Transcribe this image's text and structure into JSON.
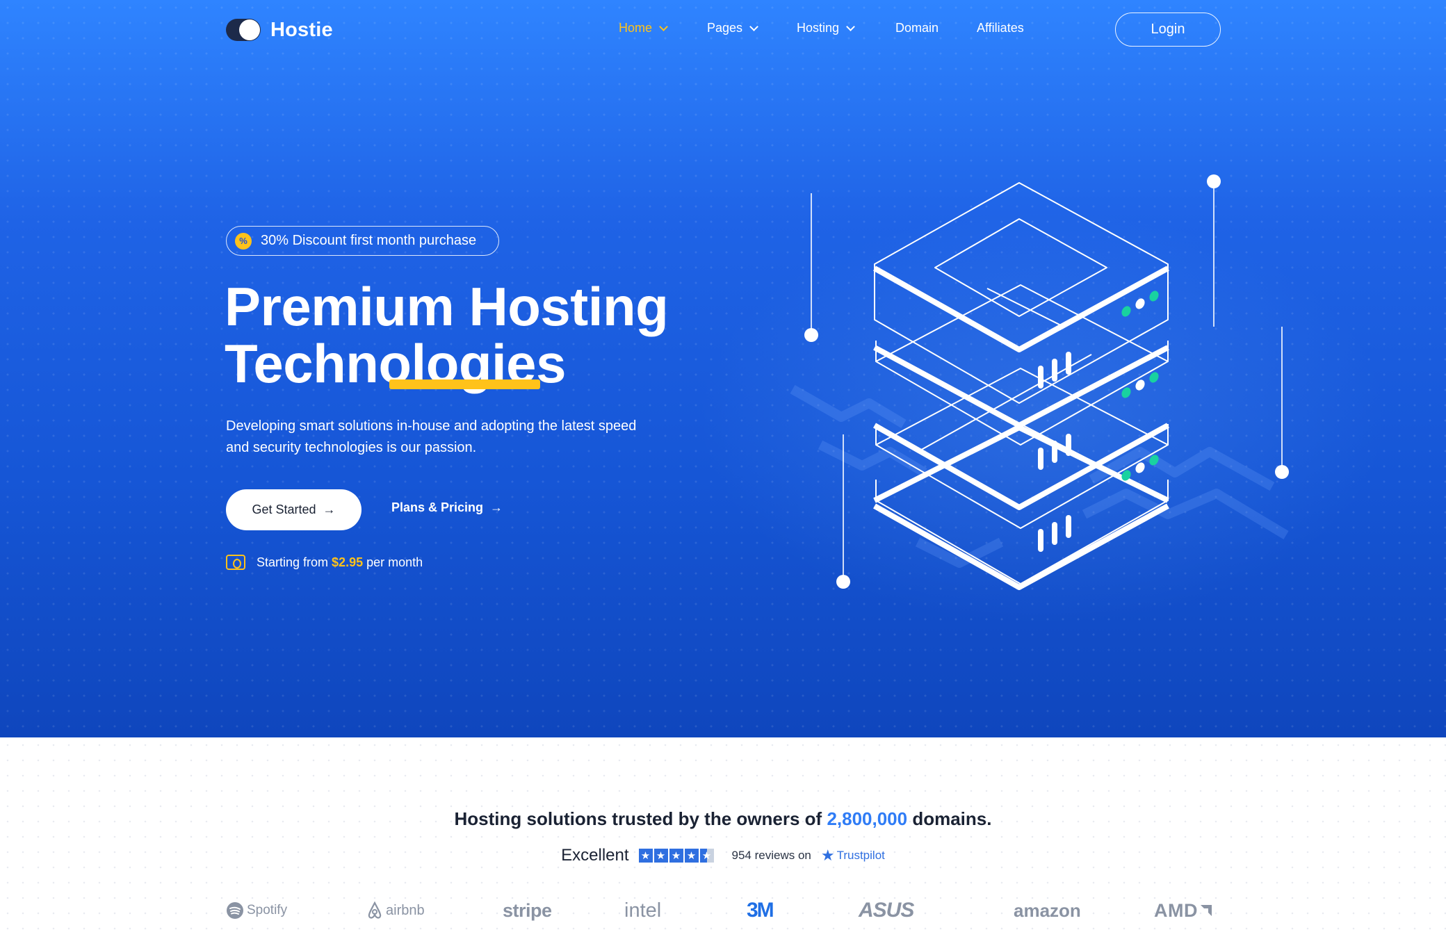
{
  "header": {
    "brand": "Hostie",
    "nav": [
      {
        "label": "Home",
        "active": true,
        "dropdown": true
      },
      {
        "label": "Pages",
        "active": false,
        "dropdown": true
      },
      {
        "label": "Hosting",
        "active": false,
        "dropdown": true
      },
      {
        "label": "Domain",
        "active": false,
        "dropdown": false
      },
      {
        "label": "Affiliates",
        "active": false,
        "dropdown": false
      }
    ],
    "login_label": "Login"
  },
  "hero": {
    "badge_icon": "%",
    "badge_text": "30% Discount first month purchase",
    "title_line1": "Premium Hosting",
    "title_line2": "Technologies",
    "description": "Developing smart solutions in-house and adopting the latest speed and security technologies is our passion.",
    "primary_button": "Get Started",
    "secondary_link": "Plans & Pricing",
    "price_prefix": "Starting from",
    "price_value": "$2.95",
    "price_suffix": "per month"
  },
  "trusted": {
    "title_prefix": "Hosting solutions trusted by the owners of",
    "title_highlight": "2,800,000",
    "title_suffix": "domains.",
    "rating_label": "Excellent",
    "reviews_text": "954 reviews on",
    "trustpilot": "Trustpilot",
    "brands": [
      "Spotify",
      "airbnb",
      "stripe",
      "intel",
      "3M",
      "ASUS",
      "amazon",
      "AMD"
    ]
  },
  "colors": {
    "accent": "#ffc21a",
    "hero_blue": "#1f63e6",
    "highlight": "#2f7cf6",
    "led_green": "#19d2a0"
  }
}
